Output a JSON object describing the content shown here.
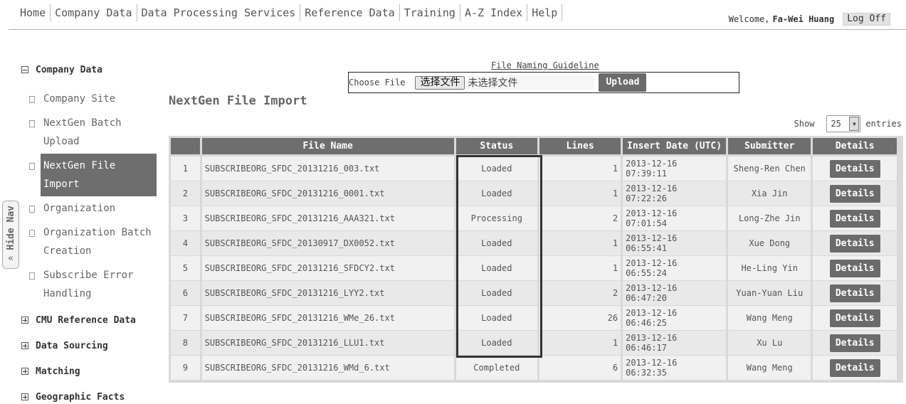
{
  "topnav": {
    "items": [
      "Home",
      "Company Data",
      "Data Processing Services",
      "Reference Data",
      "Training",
      "A-Z Index",
      "Help"
    ]
  },
  "user": {
    "welcome": "Welcome,",
    "name": "Fa-Wei Huang",
    "logoff": "Log Off"
  },
  "sidebar": {
    "company_data": "Company Data",
    "items": [
      "Company Site",
      "NextGen Batch Upload",
      "NextGen File Import",
      "Organization",
      "Organization Batch Creation",
      "Subscribe Error Handling"
    ],
    "groups": [
      "CMU Reference Data",
      "Data Sourcing",
      "Matching",
      "Geographic Facts"
    ],
    "hide_nav": "Hide Nav",
    "hide_arrow": "«"
  },
  "upload": {
    "guideline": "File Naming Guideline",
    "choose_label": "Choose File",
    "choose_button": "选择文件",
    "no_file": "未选择文件",
    "upload_button": "Upload"
  },
  "page": {
    "title": "NextGen File Import",
    "show": "Show",
    "entries_value": "25",
    "entries": "entries"
  },
  "table": {
    "headers": [
      "",
      "File Name",
      "Status",
      "Lines",
      "Insert Date (UTC)",
      "Submitter",
      "Details"
    ],
    "rows": [
      {
        "num": "1",
        "file": "SUBSCRIBEORG_SFDC_20131216_003.txt",
        "status": "Loaded",
        "lines": "1",
        "date": "2013-12-16 07:39:11",
        "submitter": "Sheng-Ren Chen",
        "details": "Details"
      },
      {
        "num": "2",
        "file": "SUBSCRIBEORG_SFDC_20131216_0001.txt",
        "status": "Loaded",
        "lines": "1",
        "date": "2013-12-16 07:22:26",
        "submitter": "Xia Jin",
        "details": "Details"
      },
      {
        "num": "3",
        "file": "SUBSCRIBEORG_SFDC_20131216_AAA321.txt",
        "status": "Processing",
        "lines": "2",
        "date": "2013-12-16 07:01:54",
        "submitter": "Long-Zhe Jin",
        "details": "Details"
      },
      {
        "num": "4",
        "file": "SUBSCRIBEORG_SFDC_20130917_DX0052.txt",
        "status": "Loaded",
        "lines": "1",
        "date": "2013-12-16 06:55:41",
        "submitter": "Xue Dong",
        "details": "Details"
      },
      {
        "num": "5",
        "file": "SUBSCRIBEORG_SFDC_20131216_SFDCY2.txt",
        "status": "Loaded",
        "lines": "1",
        "date": "2013-12-16 06:55:24",
        "submitter": "He-Ling Yin",
        "details": "Details"
      },
      {
        "num": "6",
        "file": "SUBSCRIBEORG_SFDC_20131216_LYY2.txt",
        "status": "Loaded",
        "lines": "2",
        "date": "2013-12-16 06:47:20",
        "submitter": "Yuan-Yuan Liu",
        "details": "Details"
      },
      {
        "num": "7",
        "file": "SUBSCRIBEORG_SFDC_20131216_WMe_26.txt",
        "status": "Loaded",
        "lines": "26",
        "date": "2013-12-16 06:46:25",
        "submitter": "Wang Meng",
        "details": "Details"
      },
      {
        "num": "8",
        "file": "SUBSCRIBEORG_SFDC_20131216_LLU1.txt",
        "status": "Loaded",
        "lines": "1",
        "date": "2013-12-16 06:46:17",
        "submitter": "Xu Lu",
        "details": "Details"
      },
      {
        "num": "9",
        "file": "SUBSCRIBEORG_SFDC_20131216_WMd_6.txt",
        "status": "Completed",
        "lines": "6",
        "date": "2013-12-16 06:32:35",
        "submitter": "Wang Meng",
        "details": "Details"
      }
    ]
  }
}
